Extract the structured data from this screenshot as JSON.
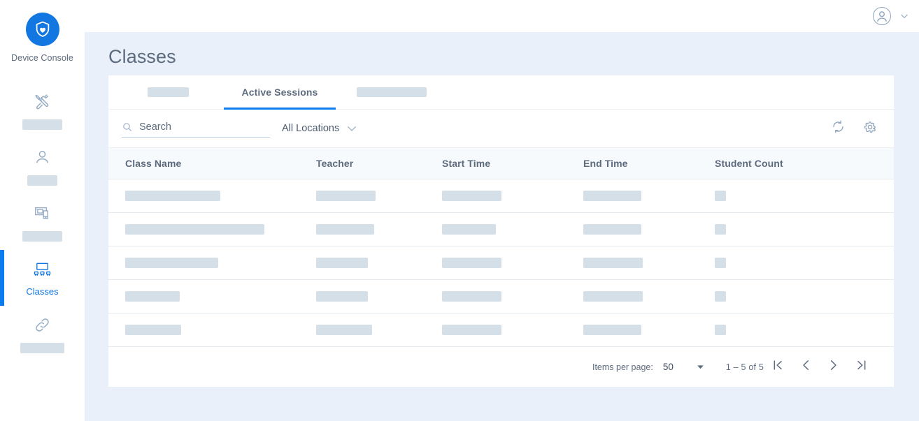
{
  "brand": {
    "name": "Device Console",
    "logo_icon": "shield-heart-icon",
    "logo_color": "#1277e0"
  },
  "sidebar": {
    "items": [
      {
        "icon": "tools-icon",
        "label": "",
        "skeleton": true,
        "skeleton_width": 57,
        "active": false
      },
      {
        "icon": "user-icon",
        "label": "",
        "skeleton": true,
        "skeleton_width": 43,
        "active": false
      },
      {
        "icon": "devices-icon",
        "label": "",
        "skeleton": true,
        "skeleton_width": 57,
        "active": false
      },
      {
        "icon": "classroom-icon",
        "label": "Classes",
        "skeleton": false,
        "skeleton_width": 0,
        "active": true
      },
      {
        "icon": "link-icon",
        "label": "",
        "skeleton": true,
        "skeleton_width": 63,
        "active": false
      }
    ]
  },
  "topbar": {
    "avatar_icon": "user-avatar-icon",
    "chevron_icon": "chevron-down-icon"
  },
  "page": {
    "title": "Classes"
  },
  "tabs": [
    {
      "label": "",
      "skeleton": true,
      "skeleton_width": 59,
      "active": false
    },
    {
      "label": "Active Sessions",
      "skeleton": false,
      "skeleton_width": 0,
      "active": true
    },
    {
      "label": "",
      "skeleton": true,
      "skeleton_width": 100,
      "active": false
    }
  ],
  "toolbar": {
    "search": {
      "icon": "search-icon",
      "value": "",
      "placeholder": "Search"
    },
    "location_filter": {
      "selected": "All Locations",
      "chevron_icon": "chevron-down-icon"
    },
    "actions": [
      {
        "icon": "refresh-icon",
        "name": "refresh-button"
      },
      {
        "icon": "gear-icon",
        "name": "settings-button"
      }
    ]
  },
  "table": {
    "columns": [
      "Class Name",
      "Teacher",
      "Start Time",
      "End Time",
      "Student Count"
    ],
    "loading": true,
    "rows": [
      {
        "skeleton_widths": [
          136,
          85,
          85,
          83,
          16
        ]
      },
      {
        "skeleton_widths": [
          199,
          83,
          77,
          83,
          16
        ]
      },
      {
        "skeleton_widths": [
          133,
          74,
          85,
          85,
          16
        ]
      },
      {
        "skeleton_widths": [
          78,
          74,
          85,
          85,
          16
        ]
      },
      {
        "skeleton_widths": [
          80,
          80,
          85,
          83,
          16
        ]
      }
    ]
  },
  "pagination": {
    "items_per_page_label": "Items per page:",
    "items_per_page_value": "50",
    "dropdown_icon": "caret-down-icon",
    "range_label": "1 – 5 of 5",
    "buttons": [
      {
        "icon": "first-page-icon",
        "name": "first-page-button"
      },
      {
        "icon": "previous-page-icon",
        "name": "previous-page-button"
      },
      {
        "icon": "next-page-icon",
        "name": "next-page-button"
      },
      {
        "icon": "last-page-icon",
        "name": "last-page-button"
      }
    ]
  },
  "theme": {
    "accent": "#0a7cf0",
    "page_background": "#e9f0fa",
    "skeleton": "#d5dfe8",
    "text": "#5d6b7e"
  }
}
